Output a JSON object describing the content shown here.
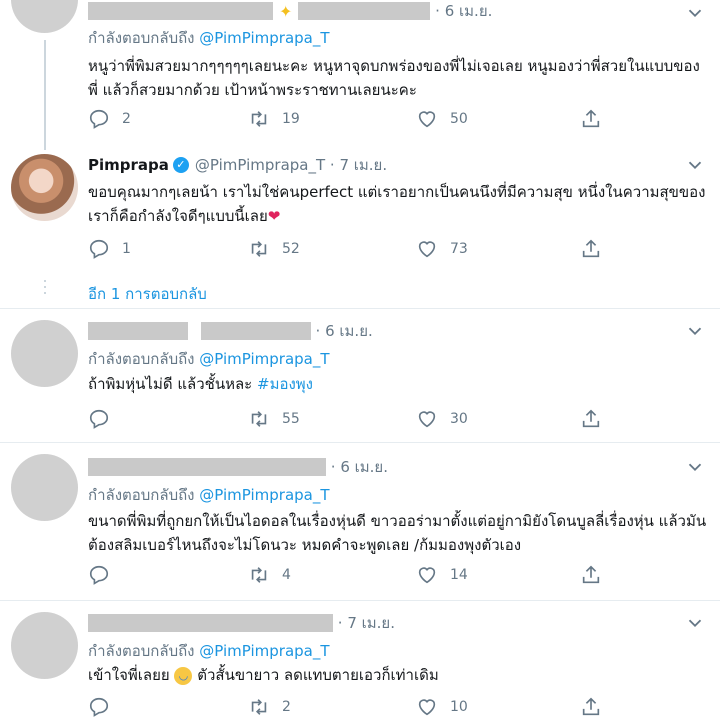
{
  "replying_label": "กำลังตอบกลับถึง",
  "replying_handle": "@PimPimprapa_T",
  "more_replies": "อีก 1 การตอบกลับ",
  "tweets": [
    {
      "date": "6 เม.ย.",
      "text": "หนูว่าพี่พิมสวยมากๆๆๆๆๆเลยนะคะ หนูหาจุดบกพร่องของพี่ไม่เจอเลย หนูมองว่าพี่สวยในแบบของพี่ แล้วก็สวยมากด้วย เป้าหน้าพระราชทานเลยนะคะ",
      "reply_count": "2",
      "retweet_count": "19",
      "like_count": "50"
    },
    {
      "name": "Pimprapa",
      "handle": "@PimPimprapa_T",
      "date": "7 เม.ย.",
      "text": "ขอบคุณมากๆเลยน้า เราไม่ใช่คนperfect แต่เราอยากเป็นคนนึงที่มีความสุข หนึ่งในความสุขของเราก็คือกำลังใจดีๆแบบนี้เลย",
      "reply_count": "1",
      "retweet_count": "52",
      "like_count": "73"
    },
    {
      "date": "6 เม.ย.",
      "text": "ถ้าพิมหุ่นไม่ดี แล้วชั้นหละ",
      "hashtag": "#มองพุง",
      "reply_count": "",
      "retweet_count": "55",
      "like_count": "30"
    },
    {
      "date": "6 เม.ย.",
      "text": "ขนาดพี่พิมที่ถูกยกให้เป็นไอดอลในเรื่องหุ่นดี ขาวออร่ามาตั้งแต่อยู่กามิยังโดนบูลลี่เรื่องหุ่น แล้วมันต้องสลิมเบอร์ไหนถึงจะไม่โดนวะ หมดคำจะพูดเลย /ก้มมองพุงตัวเอง",
      "reply_count": "",
      "retweet_count": "4",
      "like_count": "14"
    },
    {
      "date": "7 เม.ย.",
      "text_before": "เข้าใจพี่เลยย",
      "text_after": "ตัวสั้นขายาว ลดแทบตายเอวก็เท่าเดิม",
      "reply_count": "",
      "retweet_count": "2",
      "like_count": "10"
    }
  ]
}
